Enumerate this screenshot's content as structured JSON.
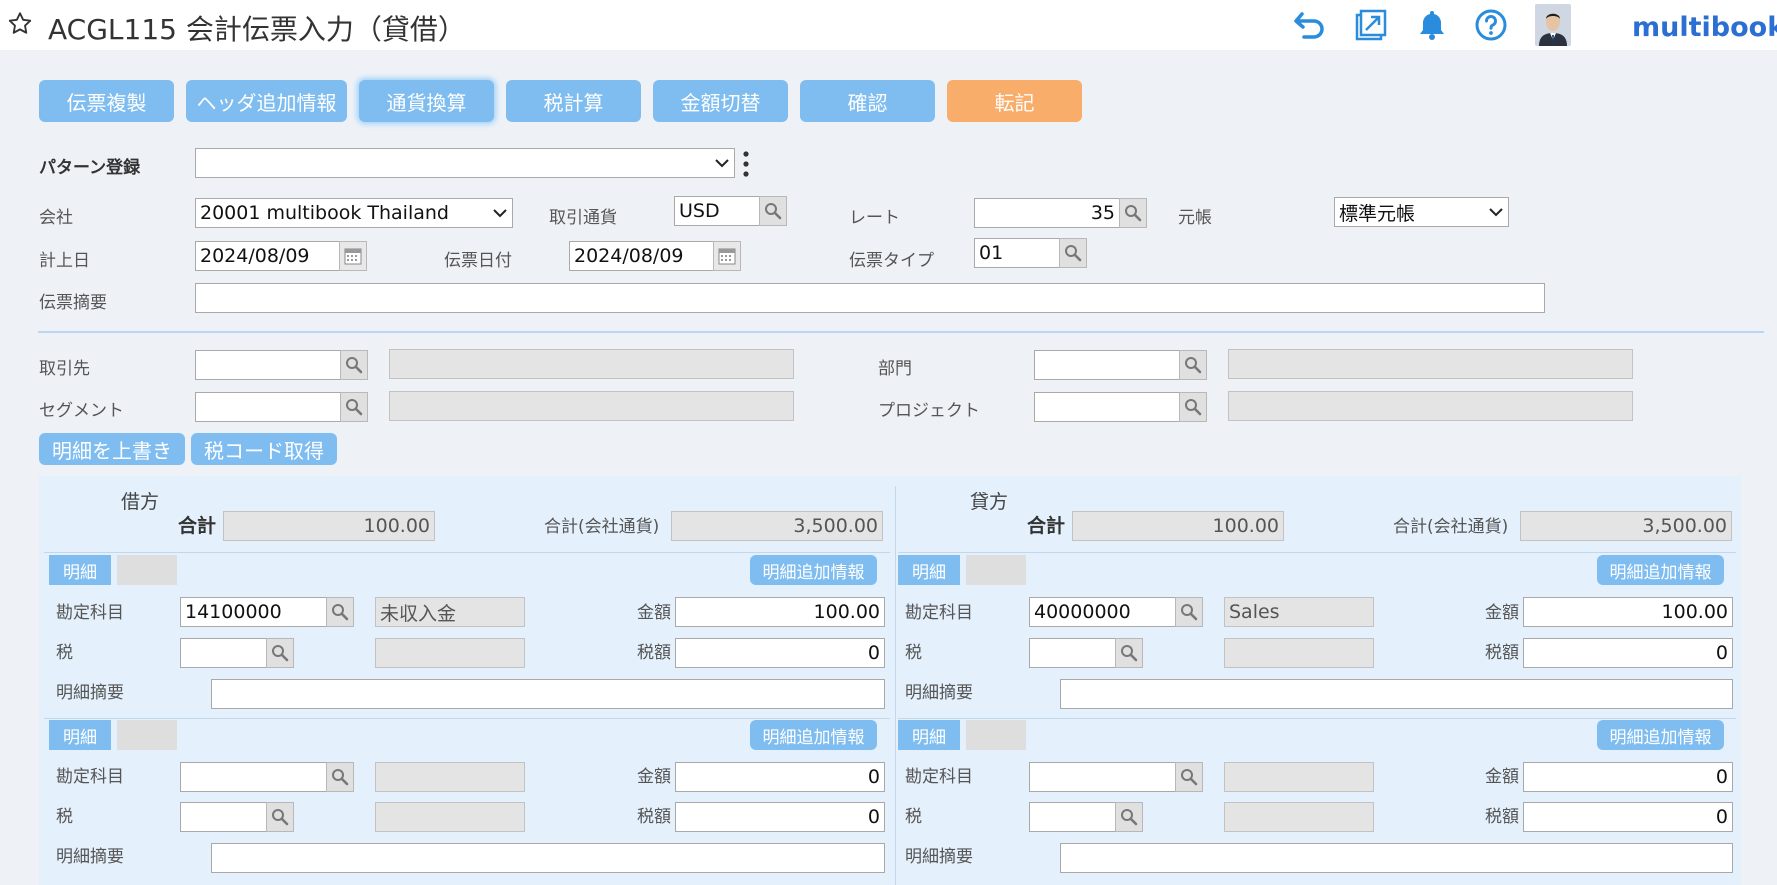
{
  "header": {
    "title": "ACGL115 会計伝票入力（貸借）",
    "brand": "multibook"
  },
  "toolbar": {
    "copy": "伝票複製",
    "header_info": "ヘッダ追加情報",
    "currency": "通貨換算",
    "tax_calc": "税計算",
    "amount_toggle": "金額切替",
    "confirm": "確認",
    "post": "転記"
  },
  "form": {
    "pattern_label": "パターン登録",
    "pattern_value": "",
    "company_label": "会社",
    "company_value": "20001 multibook Thailand",
    "currency_label": "取引通貨",
    "currency_value": "USD",
    "rate_label": "レート",
    "rate_value": "35",
    "ledger_label": "元帳",
    "ledger_value": "標準元帳",
    "posting_date_label": "計上日",
    "posting_date_value": "2024/08/09",
    "doc_date_label": "伝票日付",
    "doc_date_value": "2024/08/09",
    "doc_type_label": "伝票タイプ",
    "doc_type_value": "01",
    "memo_label": "伝票摘要",
    "memo_value": ""
  },
  "dims": {
    "partner_label": "取引先",
    "dept_label": "部門",
    "segment_label": "セグメント",
    "project_label": "プロジェクト"
  },
  "actions": {
    "overwrite": "明細を上書き",
    "tax_code": "税コード取得"
  },
  "debit": {
    "title": "借方",
    "total_label": "合計",
    "total_value": "100.00",
    "company_total_label": "合計(会社通貨)",
    "company_total_value": "3,500.00",
    "lines": [
      {
        "tag": "明細",
        "add": "明細追加情報",
        "account_label": "勘定科目",
        "account": "14100000",
        "account_name": "未収入金",
        "amount_label": "金額",
        "amount": "100.00",
        "tax_label": "税",
        "tax": "",
        "tax_amount_label": "税額",
        "tax_amount": "0",
        "memo_label": "明細摘要",
        "memo": ""
      },
      {
        "tag": "明細",
        "add": "明細追加情報",
        "account_label": "勘定科目",
        "account": "",
        "account_name": "",
        "amount_label": "金額",
        "amount": "0",
        "tax_label": "税",
        "tax": "",
        "tax_amount_label": "税額",
        "tax_amount": "0",
        "memo_label": "明細摘要",
        "memo": ""
      }
    ]
  },
  "credit": {
    "title": "貸方",
    "total_label": "合計",
    "total_value": "100.00",
    "company_total_label": "合計(会社通貨)",
    "company_total_value": "3,500.00",
    "lines": [
      {
        "tag": "明細",
        "add": "明細追加情報",
        "account_label": "勘定科目",
        "account": "40000000",
        "account_name": "Sales",
        "amount_label": "金額",
        "amount": "100.00",
        "tax_label": "税",
        "tax": "",
        "tax_amount_label": "税額",
        "tax_amount": "0",
        "memo_label": "明細摘要",
        "memo": ""
      },
      {
        "tag": "明細",
        "add": "明細追加情報",
        "account_label": "勘定科目",
        "account": "",
        "account_name": "",
        "amount_label": "金額",
        "amount": "0",
        "tax_label": "税",
        "tax": "",
        "tax_amount_label": "税額",
        "tax_amount": "0",
        "memo_label": "明細摘要",
        "memo": ""
      }
    ]
  },
  "colors": {
    "accent": "#7fbdf1",
    "post": "#f8ad6a",
    "brand": "#2a6fd1",
    "panel": "#e4f0fb"
  },
  "icons": [
    "star-icon",
    "undo-icon",
    "external-link-icon",
    "bell-icon",
    "help-icon",
    "search-icon",
    "calendar-icon",
    "more-icon",
    "chevron-down-icon"
  ]
}
